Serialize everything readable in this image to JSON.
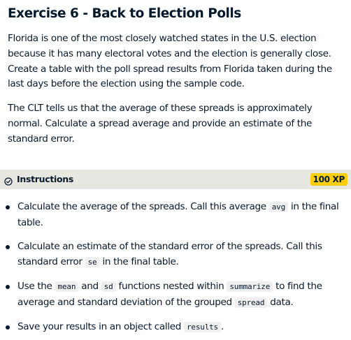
{
  "exercise": {
    "title": "Exercise 6 - Back to Election Polls",
    "paragraphs": [
      "Florida is one of the most closely watched states in the U.S. election because it has many electoral votes and the election is generally close. Create a table with the poll spread results from Florida taken during the last days before the election using the sample code.",
      "The CLT tells us that the average of these spreads is approximately normal. Calculate a spread average and provide an estimate of the standard error."
    ]
  },
  "instructions": {
    "icon": "check-circle-icon",
    "label": "Instructions",
    "xp": "100 XP",
    "items": [
      {
        "t1": "Calculate the average of the spreads. Call this average ",
        "c1": "avg",
        "t2": " in the final table."
      },
      {
        "t1": "Calculate an estimate of the standard error of the spreads. Call this standard error ",
        "c1": "se",
        "t2": " in the final table."
      },
      {
        "t1": "Use the ",
        "c1": "mean",
        "t2": " and ",
        "c2": "sd",
        "t3": " functions nested within ",
        "c3": "summarize",
        "t4": " to find the average and standard deviation of the grouped ",
        "c4": "spread",
        "t5": " data."
      },
      {
        "t1": "Save your results in an object called ",
        "c1": "results",
        "t2": "."
      }
    ]
  },
  "colors": {
    "text": "#05192d",
    "xp_badge": "#fcce0d",
    "instructions_bar": "#e8e6e1",
    "code_bg": "#efefef"
  }
}
